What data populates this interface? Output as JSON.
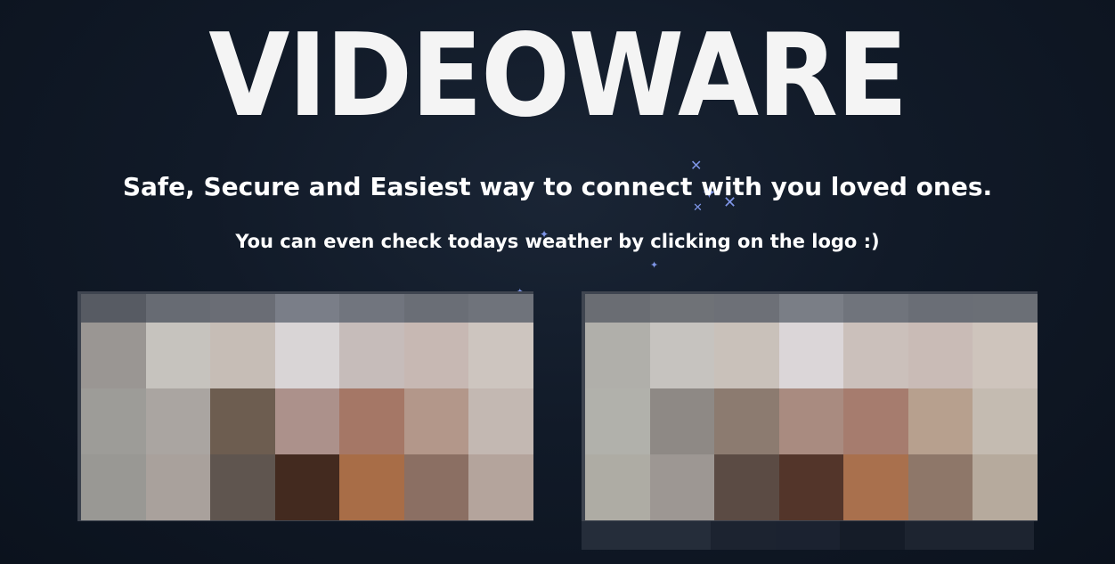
{
  "logo": {
    "text": "VideoWare"
  },
  "tagline": "Safe, Secure and Easiest way to connect with you loved ones.",
  "subline": "You can even check todays weather by clicking on the logo :)",
  "colors": {
    "background": "#111a28",
    "sparkle": "#7e95e6",
    "text": "#ffffff"
  },
  "videos": {
    "left": {
      "tiles": [
        "#575b63",
        "#676b73",
        "#6a6d75",
        "#7a7e88",
        "#71757e",
        "#6a6e76",
        "#6f737b",
        "#9a9693",
        "#c6c3be",
        "#c6bdb6",
        "#d9d5d6",
        "#c6bcba",
        "#c7b8b3",
        "#cdc5bf",
        "#9d9c98",
        "#aaa5a1",
        "#6d5d50",
        "#ac918b",
        "#a57766",
        "#b3978a",
        "#c3b8b2",
        "#999894",
        "#a9a19c",
        "#5f554f",
        "#432a1f",
        "#a86d47",
        "#8b6f63",
        "#b4a49c"
      ]
    },
    "right": {
      "tiles": [
        "#6a6d73",
        "#6f7277",
        "#6d7077",
        "#7a7e86",
        "#70747c",
        "#6a6e76",
        "#6b6f76",
        "#b0afaa",
        "#c6c3bf",
        "#c9c1ba",
        "#dbd6d8",
        "#cbc0bb",
        "#c9bbb6",
        "#cec4bc",
        "#b1b1ab",
        "#8e8985",
        "#8c7b70",
        "#a98b80",
        "#a67c6e",
        "#b7a08e",
        "#c4bbb1",
        "#aeaca4",
        "#9d9793",
        "#5b4b44",
        "#53352a",
        "#a9704d",
        "#8e7769",
        "#b6aa9d"
      ],
      "strip": [
        "#252d3a",
        "#252d3a",
        "#1c2330",
        "#1b2230",
        "#151c28",
        "#1d2430",
        "#1d2430"
      ]
    }
  }
}
